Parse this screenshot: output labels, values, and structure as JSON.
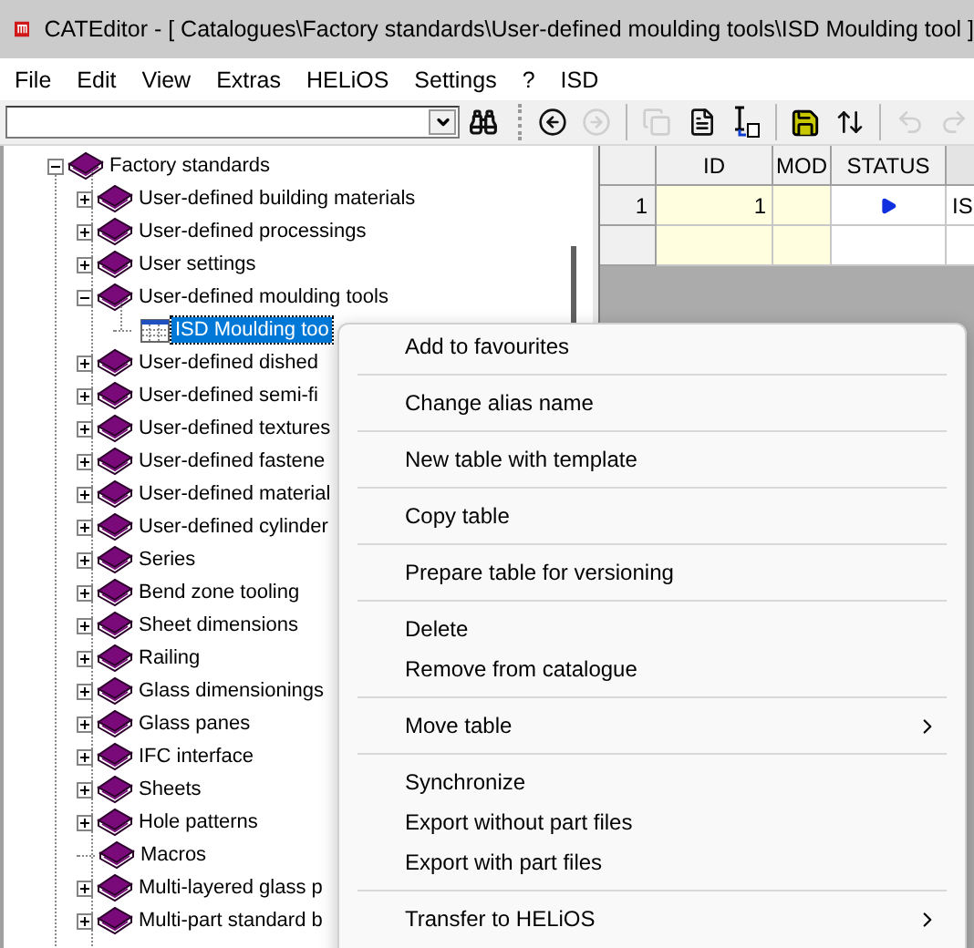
{
  "window": {
    "title": "CATEditor - [ Catalogues\\Factory standards\\User-defined moulding tools\\ISD Moulding tool ]"
  },
  "menu_bar": [
    "File",
    "Edit",
    "View",
    "Extras",
    "HELiOS",
    "Settings",
    "?",
    "ISD"
  ],
  "toolbar": {
    "search_combo": {
      "value_empty": true
    },
    "buttons": [
      {
        "kind": "back",
        "disabled": false
      },
      {
        "kind": "forward",
        "disabled": true
      },
      {
        "kind": "sep"
      },
      {
        "kind": "copy",
        "disabled": true
      },
      {
        "kind": "document",
        "disabled": false
      },
      {
        "kind": "table-cursor",
        "disabled": false
      },
      {
        "kind": "sep"
      },
      {
        "kind": "save",
        "disabled": false
      },
      {
        "kind": "sort",
        "disabled": false
      },
      {
        "kind": "sep"
      },
      {
        "kind": "undo",
        "disabled": true
      },
      {
        "kind": "redo",
        "disabled": true
      }
    ]
  },
  "tree": {
    "label": "Factory standards",
    "expanded": true,
    "children": [
      {
        "label": "User-defined building materials",
        "kind": "catalogue",
        "expandable": true,
        "expanded": false,
        "selected": false
      },
      {
        "label": "User-defined processings",
        "kind": "catalogue",
        "expandable": true,
        "expanded": false,
        "selected": false
      },
      {
        "label": "User settings",
        "kind": "catalogue",
        "expandable": true,
        "expanded": false,
        "selected": false
      },
      {
        "label": "User-defined moulding tools",
        "kind": "catalogue",
        "expandable": true,
        "expanded": true,
        "selected": false,
        "children": [
          {
            "label": "ISD Moulding too",
            "kind": "table",
            "selected": true
          }
        ]
      },
      {
        "label": "User-defined dished",
        "kind": "catalogue",
        "expandable": true,
        "expanded": false,
        "selected": false
      },
      {
        "label": "User-defined semi-fi",
        "kind": "catalogue",
        "expandable": true,
        "expanded": false,
        "selected": false
      },
      {
        "label": "User-defined textures",
        "kind": "catalogue",
        "expandable": true,
        "expanded": false,
        "selected": false
      },
      {
        "label": "User-defined fastene",
        "kind": "catalogue",
        "expandable": true,
        "expanded": false,
        "selected": false
      },
      {
        "label": "User-defined material",
        "kind": "catalogue",
        "expandable": true,
        "expanded": false,
        "selected": false
      },
      {
        "label": "User-defined cylinder",
        "kind": "catalogue",
        "expandable": true,
        "expanded": false,
        "selected": false
      },
      {
        "label": "Series",
        "kind": "catalogue",
        "expandable": true,
        "expanded": false,
        "selected": false
      },
      {
        "label": "Bend zone tooling",
        "kind": "catalogue",
        "expandable": true,
        "expanded": false,
        "selected": false
      },
      {
        "label": "Sheet dimensions",
        "kind": "catalogue",
        "expandable": true,
        "expanded": false,
        "selected": false
      },
      {
        "label": "Railing",
        "kind": "catalogue",
        "expandable": true,
        "expanded": false,
        "selected": false
      },
      {
        "label": "Glass dimensionings",
        "kind": "catalogue",
        "expandable": true,
        "expanded": false,
        "selected": false
      },
      {
        "label": "Glass panes",
        "kind": "catalogue",
        "expandable": true,
        "expanded": false,
        "selected": false
      },
      {
        "label": "IFC interface",
        "kind": "catalogue",
        "expandable": true,
        "expanded": false,
        "selected": false
      },
      {
        "label": "Sheets",
        "kind": "catalogue",
        "expandable": true,
        "expanded": false,
        "selected": false
      },
      {
        "label": "Hole patterns",
        "kind": "catalogue",
        "expandable": true,
        "expanded": false,
        "selected": false
      },
      {
        "label": "Macros",
        "kind": "catalogue",
        "expandable": false,
        "expanded": false,
        "selected": false
      },
      {
        "label": "Multi-layered glass p",
        "kind": "catalogue",
        "expandable": true,
        "expanded": false,
        "selected": false
      },
      {
        "label": "Multi-part standard b",
        "kind": "catalogue",
        "expandable": true,
        "expanded": false,
        "selected": false
      }
    ]
  },
  "grid": {
    "columns": [
      "ID",
      "MOD",
      "STATUS"
    ],
    "rows": [
      {
        "header": "1",
        "id": "1",
        "current": true,
        "column_4": "IS"
      },
      {
        "current": false
      }
    ]
  },
  "context_menu": {
    "groups": [
      [
        {
          "label": "Add to favourites",
          "submenu": false
        }
      ],
      [
        {
          "label": "Change alias name",
          "submenu": false
        }
      ],
      [
        {
          "label": "New table with template",
          "submenu": false
        }
      ],
      [
        {
          "label": "Copy table",
          "submenu": false
        }
      ],
      [
        {
          "label": "Prepare table for versioning",
          "submenu": false
        }
      ],
      [
        {
          "label": "Delete",
          "submenu": false
        },
        {
          "label": "Remove from catalogue",
          "submenu": false
        }
      ],
      [
        {
          "label": "Move table",
          "submenu": true
        }
      ],
      [
        {
          "label": "Synchronize",
          "submenu": false
        },
        {
          "label": "Export without part files",
          "submenu": false
        },
        {
          "label": "Export with part files",
          "submenu": false
        }
      ],
      [
        {
          "label": "Transfer to HELiOS",
          "submenu": true
        }
      ]
    ]
  }
}
